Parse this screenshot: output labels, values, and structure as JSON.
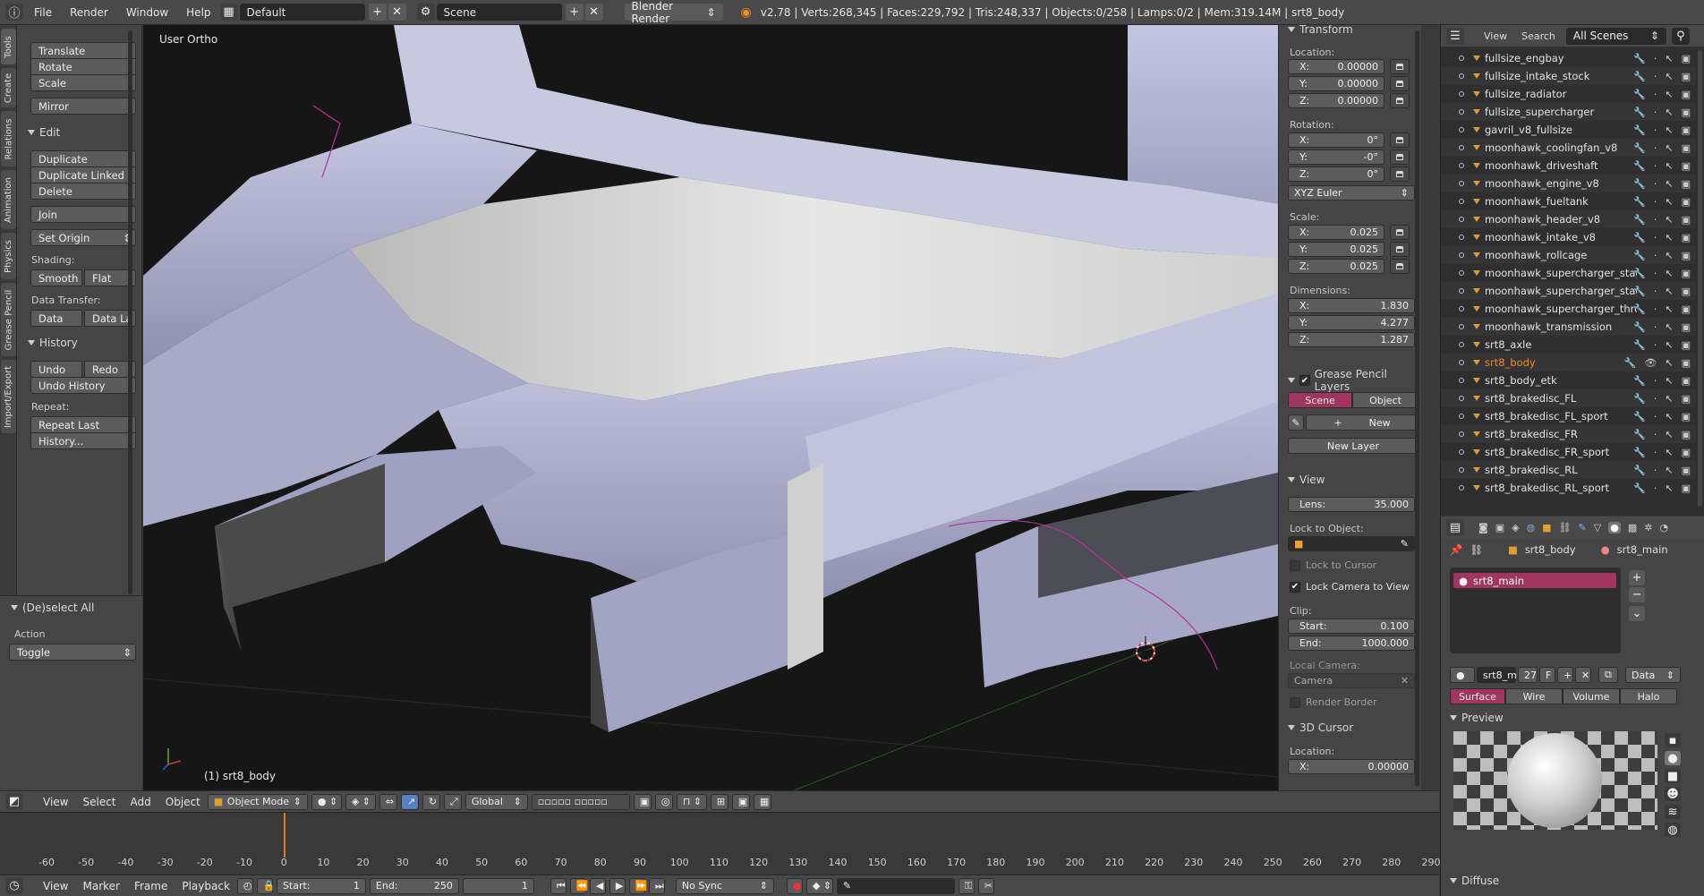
{
  "topbar": {
    "menus": [
      "File",
      "Render",
      "Window",
      "Help"
    ],
    "layout": "Default",
    "scene": "Scene",
    "engine": "Blender Render",
    "stats": "v2.78 | Verts:268,345 | Faces:229,792 | Tris:248,337 | Objects:0/258 | Lamps:0/2 | Mem:319.14M | srt8_body"
  },
  "tabs": [
    "Tools",
    "Create",
    "Relations",
    "Animation",
    "Physics",
    "Grease Pencil",
    "Import/Export"
  ],
  "toolshelf": {
    "top_buttons": [
      "Translate",
      "Rotate",
      "Scale"
    ],
    "mirror": "Mirror",
    "edit_title": "Edit",
    "edit_buttons": [
      "Duplicate",
      "Duplicate Linked",
      "Delete"
    ],
    "join": "Join",
    "set_origin": "Set Origin",
    "shading_label": "Shading:",
    "smooth": "Smooth",
    "flat": "Flat",
    "data_transfer_label": "Data Transfer:",
    "data": "Data",
    "data_la": "Data La",
    "history_title": "History",
    "undo": "Undo",
    "redo": "Redo",
    "undo_history": "Undo History",
    "repeat_label": "Repeat:",
    "repeat_last": "Repeat Last",
    "history_dots": "History..."
  },
  "last_operator": {
    "title": "(De)select All",
    "action_label": "Action",
    "action_value": "Toggle"
  },
  "viewport": {
    "view_label": "User Ortho",
    "object_label": "(1) srt8_body"
  },
  "npanel": {
    "transform_title": "Transform",
    "location_label": "Location:",
    "location": [
      {
        "axis": "X:",
        "value": "0.00000"
      },
      {
        "axis": "Y:",
        "value": "0.00000"
      },
      {
        "axis": "Z:",
        "value": "0.00000"
      }
    ],
    "rotation_label": "Rotation:",
    "rotation": [
      {
        "axis": "X:",
        "value": "0°"
      },
      {
        "axis": "Y:",
        "value": "-0°"
      },
      {
        "axis": "Z:",
        "value": "0°"
      }
    ],
    "rotation_mode": "XYZ Euler",
    "scale_label": "Scale:",
    "scale": [
      {
        "axis": "X:",
        "value": "0.025"
      },
      {
        "axis": "Y:",
        "value": "0.025"
      },
      {
        "axis": "Z:",
        "value": "0.025"
      }
    ],
    "dimensions_label": "Dimensions:",
    "dimensions": [
      {
        "axis": "X:",
        "value": "1.830"
      },
      {
        "axis": "Y:",
        "value": "4.277"
      },
      {
        "axis": "Z:",
        "value": "1.287"
      }
    ],
    "gp_title": "Grease Pencil Layers",
    "gp_scene": "Scene",
    "gp_object": "Object",
    "gp_new": "New",
    "gp_new_layer": "New Layer",
    "view_title": "View",
    "lens_label": "Lens:",
    "lens_value": "35.000",
    "lock_to_object": "Lock to Object:",
    "lock_to_cursor": "Lock to Cursor",
    "lock_camera": "Lock Camera to View",
    "clip_label": "Clip:",
    "clip_start_label": "Start:",
    "clip_start": "0.100",
    "clip_end_label": "End:",
    "clip_end": "1000.000",
    "local_camera": "Local Camera:",
    "camera": "Camera",
    "render_border": "Render Border",
    "cursor_title": "3D Cursor",
    "cursor_location": "Location:",
    "cursor_x_label": "X:",
    "cursor_x": "0.00000"
  },
  "outliner": {
    "menu_view": "View",
    "menu_search": "Search",
    "filter": "All Scenes",
    "items": [
      "fullsize_engbay",
      "fullsize_intake_stock",
      "fullsize_radiator",
      "fullsize_supercharger",
      "gavril_v8_fullsize",
      "moonhawk_coolingfan_v8",
      "moonhawk_driveshaft",
      "moonhawk_engine_v8",
      "moonhawk_fueltank",
      "moonhawk_header_v8",
      "moonhawk_intake_v8",
      "moonhawk_rollcage",
      "moonhawk_supercharger_stage",
      "moonhawk_supercharger_stage",
      "moonhawk_supercharger_thrott",
      "moonhawk_transmission",
      "srt8_axle",
      "srt8_body",
      "srt8_body_etk",
      "srt8_brakedisc_FL",
      "srt8_brakedisc_FL_sport",
      "srt8_brakedisc_FR",
      "srt8_brakedisc_FR_sport",
      "srt8_brakedisc_RL",
      "srt8_brakedisc_RL_sport"
    ],
    "selected": "srt8_body"
  },
  "properties": {
    "crumb_object": "srt8_body",
    "crumb_material": "srt8_main",
    "slot_name": "srt8_main",
    "mat_name": "srt8_m",
    "users": "27",
    "fake": "F",
    "link": "Data",
    "tabs": [
      "Surface",
      "Wire",
      "Volume",
      "Halo"
    ],
    "preview_title": "Preview",
    "diffuse_title": "Diffuse"
  },
  "viewport_header": {
    "menus": [
      "View",
      "Select",
      "Add",
      "Object"
    ],
    "mode": "Object Mode",
    "orientation": "Global"
  },
  "timeline": {
    "ticks": [
      "-60",
      "-50",
      "-40",
      "-30",
      "-20",
      "-10",
      "0",
      "10",
      "20",
      "30",
      "40",
      "50",
      "60",
      "70",
      "80",
      "90",
      "100",
      "110",
      "120",
      "130",
      "140",
      "150",
      "160",
      "170",
      "180",
      "190",
      "200",
      "210",
      "220",
      "230",
      "240",
      "250",
      "260",
      "270",
      "280",
      "290"
    ],
    "menus": [
      "View",
      "Marker",
      "Frame",
      "Playback"
    ],
    "start_label": "Start:",
    "start": "1",
    "end_label": "End:",
    "end": "250",
    "current": "1",
    "sync": "No Sync"
  },
  "colors": {
    "selected_text": "#f08a24",
    "accent_pink": "#a0355d",
    "mesh": "#b7b8cf",
    "frame_cursor": "#e2791c"
  }
}
